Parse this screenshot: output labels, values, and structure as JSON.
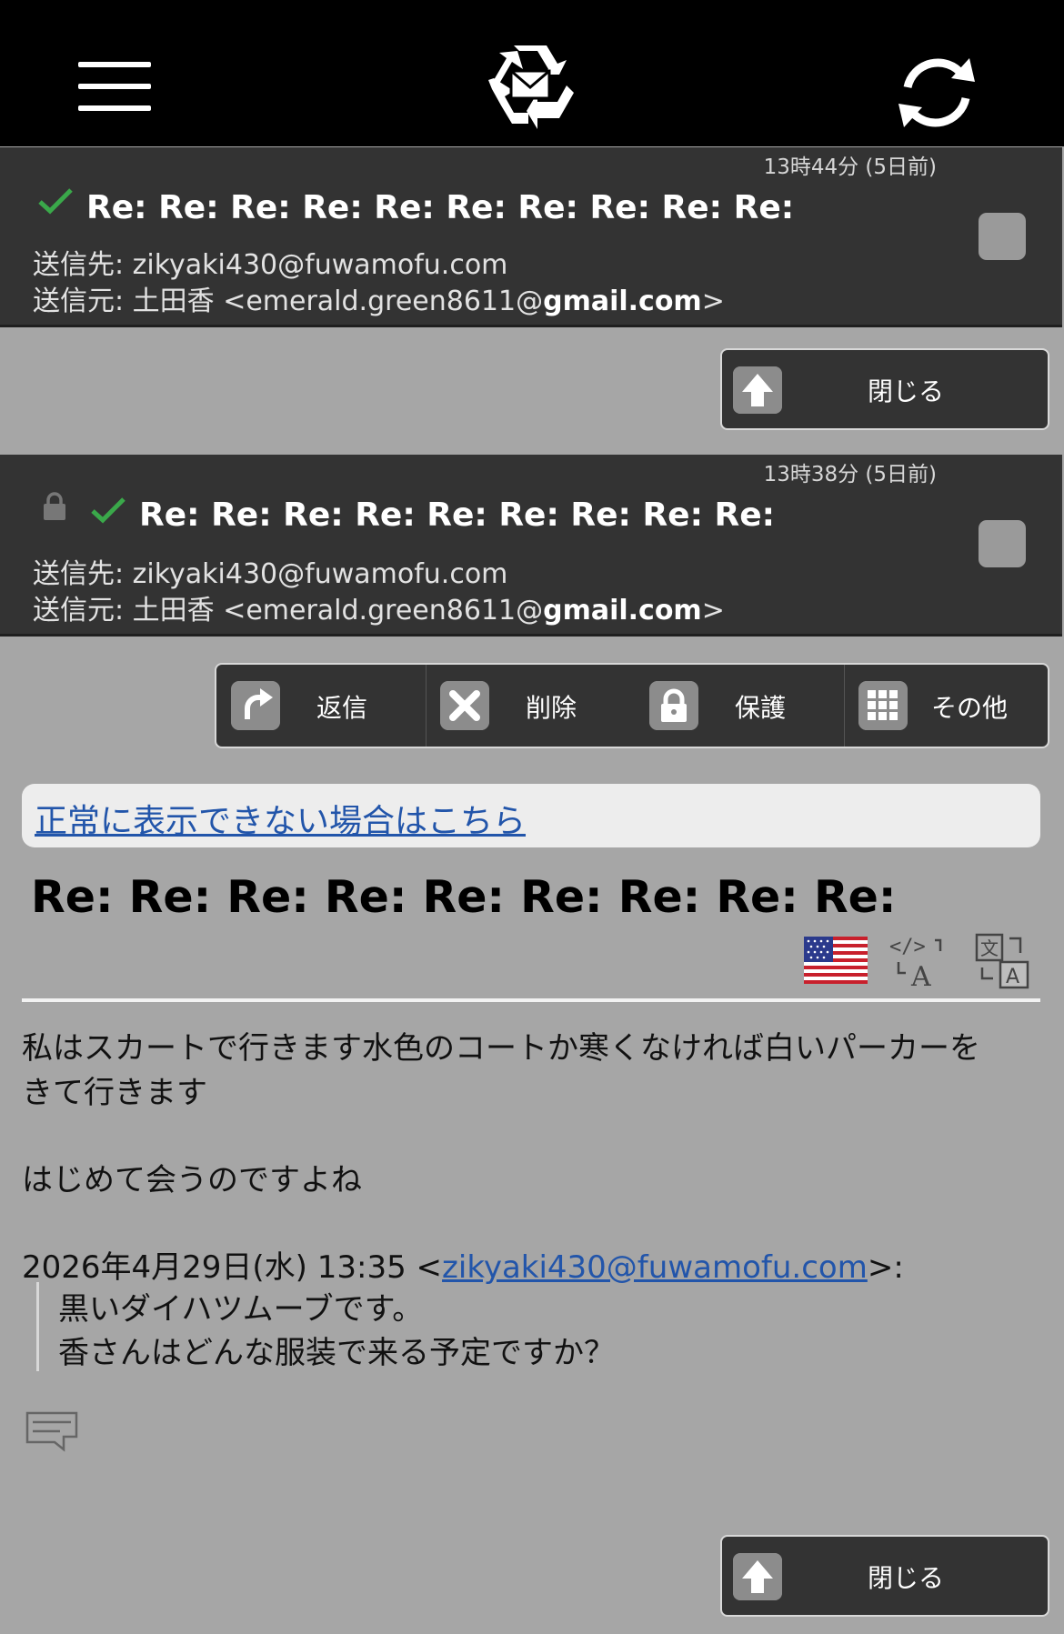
{
  "header": {
    "menu_icon": "hamburger-menu-icon",
    "logo_icon": "recycle-mail-logo",
    "refresh_icon": "refresh-icon"
  },
  "mails": [
    {
      "time": "13時44分 (5日前)",
      "subject": "Re: Re: Re: Re: Re: Re: Re: Re: Re: Re:",
      "to_label": "送信先:",
      "to": "zikyaki430@fuwamofu.com",
      "from_label": "送信元:",
      "from_name": "土田香 <emerald.green8611@",
      "from_domain": "gmail.com",
      "from_end": ">",
      "locked": false,
      "read": true
    },
    {
      "time": "13時38分 (5日前)",
      "subject": "Re: Re: Re: Re: Re: Re: Re: Re: Re:",
      "to_label": "送信先:",
      "to": "zikyaki430@fuwamofu.com",
      "from_label": "送信元:",
      "from_name": "土田香 <emerald.green8611@",
      "from_domain": "gmail.com",
      "from_end": ">",
      "locked": true,
      "read": true
    }
  ],
  "close_label": "閉じる",
  "actions": {
    "reply": "返信",
    "delete": "削除",
    "protect": "保護",
    "more": "その他"
  },
  "notice_link": "正常に表示できない場合はこちら",
  "message": {
    "subject": "Re: Re: Re: Re: Re: Re: Re: Re: Re:",
    "body_line1": "私はスカートで行きます水色のコートか寒くなければ白いパーカーを",
    "body_line2": "きて行きます",
    "body_line3": "はじめて会うのですよね",
    "quote_header_prefix": "2026年4月29日(水) 13:35 <",
    "quote_header_email": "zikyaki430@fuwamofu.com",
    "quote_header_suffix": ">:",
    "quote_line1": "黒いダイハツムーブです。",
    "quote_line2": "香さんはどんな服装で来る予定ですか？"
  },
  "colors": {
    "topbar": "#000000",
    "mail_bg": "#333333",
    "page_bg": "#a6a6a6",
    "check": "#3aa84a",
    "link": "#2255aa"
  }
}
